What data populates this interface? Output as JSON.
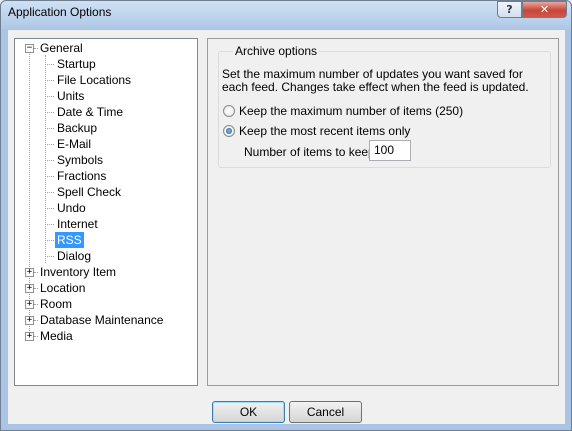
{
  "window": {
    "title": "Application Options",
    "help_glyph": "?",
    "close_glyph": "✕"
  },
  "tree": {
    "items": [
      {
        "label": "General",
        "expanded": true
      },
      {
        "label": "Startup"
      },
      {
        "label": "File Locations"
      },
      {
        "label": "Units"
      },
      {
        "label": "Date & Time"
      },
      {
        "label": "Backup"
      },
      {
        "label": "E-Mail"
      },
      {
        "label": "Symbols"
      },
      {
        "label": "Fractions"
      },
      {
        "label": "Spell Check"
      },
      {
        "label": "Undo"
      },
      {
        "label": "Internet"
      },
      {
        "label": "RSS",
        "selected": true
      },
      {
        "label": "Dialog"
      },
      {
        "label": "Inventory Item",
        "expanded": false
      },
      {
        "label": "Location",
        "expanded": false
      },
      {
        "label": "Room",
        "expanded": false
      },
      {
        "label": "Database Maintenance",
        "expanded": false
      },
      {
        "label": "Media",
        "expanded": false
      }
    ]
  },
  "archive": {
    "title": "Archive options",
    "description": "Set the maximum number of updates you want saved for each feed. Changes take effect when the feed is updated.",
    "option_max": "Keep the maximum number of items (250)",
    "option_recent": "Keep the most recent items only",
    "selected_option": "recent",
    "items_label": "Number of items to keep:",
    "items_value": "100"
  },
  "buttons": {
    "ok": "OK",
    "cancel": "Cancel"
  },
  "colors": {
    "selection": "#3399ff",
    "titlebar": "#b9d0ea",
    "close": "#c7463a"
  }
}
